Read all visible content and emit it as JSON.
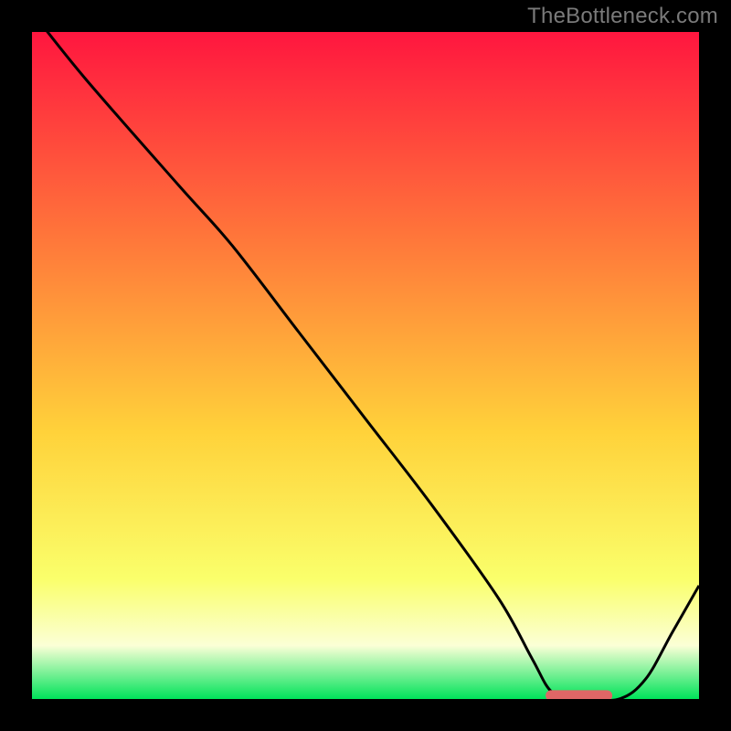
{
  "watermark": "TheBottleneck.com",
  "colors": {
    "bg": "#000000",
    "grad_top": "#ff163f",
    "grad_mid_upper": "#ff7a3a",
    "grad_mid": "#ffd23a",
    "grad_low_yellow": "#faff6b",
    "grad_pale": "#fbffd6",
    "grad_green": "#00e35a",
    "curve": "#000000",
    "marker": "#e06666"
  },
  "chart_data": {
    "type": "line",
    "title": "",
    "xlabel": "",
    "ylabel": "",
    "xlim": [
      0,
      100
    ],
    "ylim": [
      0,
      100
    ],
    "x": [
      0,
      8,
      22,
      30,
      40,
      50,
      60,
      70,
      75,
      78,
      82,
      88,
      92,
      96,
      100
    ],
    "values": [
      103,
      93,
      77,
      68,
      55,
      42,
      29,
      15,
      6,
      1,
      0,
      0,
      3,
      10,
      17
    ],
    "marker_segment": {
      "x_start": 77,
      "x_end": 87,
      "y": 0.5
    }
  }
}
